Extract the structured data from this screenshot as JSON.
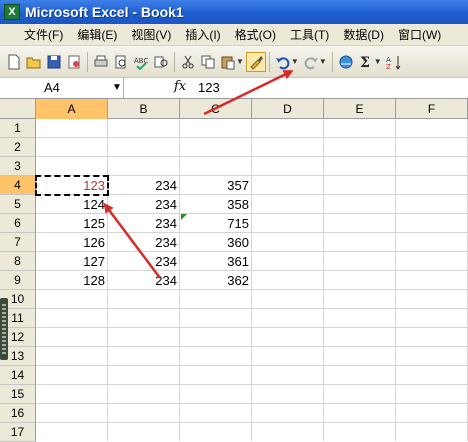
{
  "window": {
    "title": "Microsoft Excel - Book1",
    "app_icon_glyph": "X"
  },
  "menu": {
    "items": [
      "文件(F)",
      "编辑(E)",
      "视图(V)",
      "插入(I)",
      "格式(O)",
      "工具(T)",
      "数据(D)",
      "窗口(W)"
    ]
  },
  "toolbar": {
    "buttons": [
      "new-icon",
      "open-icon",
      "save-icon",
      "permission-icon",
      "print-icon",
      "print-preview-icon",
      "spelling-icon",
      "research-icon",
      "cut-icon",
      "copy-icon",
      "paste-icon",
      "format-painter-icon",
      "undo-icon",
      "redo-icon",
      "hyperlink-icon",
      "autosum-icon",
      "sort-icon"
    ],
    "active_button": "format-painter-icon"
  },
  "formula_bar": {
    "name_box": "A4",
    "fx_label": "fx",
    "content": "123"
  },
  "sheet": {
    "columns": [
      "A",
      "B",
      "C",
      "D",
      "E",
      "F"
    ],
    "rows": [
      "1",
      "2",
      "3",
      "4",
      "5",
      "6",
      "7",
      "8",
      "9",
      "10",
      "11",
      "12",
      "13",
      "14",
      "15",
      "16",
      "17"
    ],
    "selected_column": "A",
    "selected_row": "4",
    "data_rows": [
      {
        "row": "4",
        "a": "123",
        "b": "234",
        "c": "357"
      },
      {
        "row": "5",
        "a": "124",
        "b": "234",
        "c": "358"
      },
      {
        "row": "6",
        "a": "125",
        "b": "234",
        "c": "715"
      },
      {
        "row": "7",
        "a": "126",
        "b": "234",
        "c": "360"
      },
      {
        "row": "8",
        "a": "127",
        "b": "234",
        "c": "361"
      },
      {
        "row": "9",
        "a": "128",
        "b": "234",
        "c": "362"
      }
    ]
  },
  "colors": {
    "selection_header": "#ffc46a",
    "arrow": "#d42a2a",
    "title_bar": "#1f5fd0",
    "error_indicator": "#1f8f3a"
  }
}
